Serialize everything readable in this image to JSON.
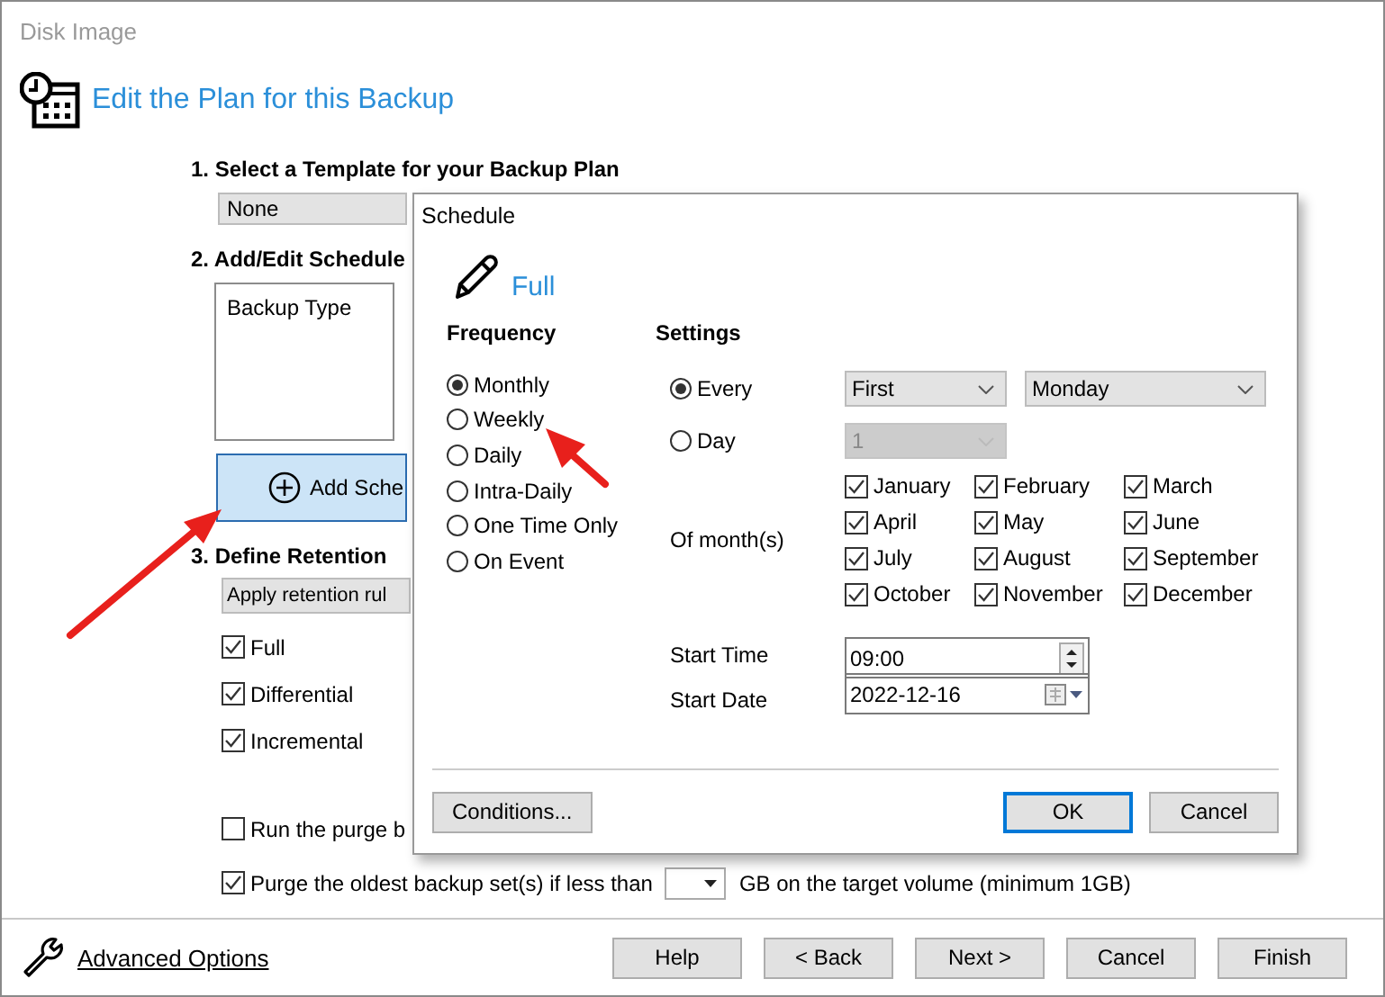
{
  "window": {
    "title": "Disk Image"
  },
  "header": {
    "title": "Edit the Plan for this Backup"
  },
  "template_section": {
    "heading": "1. Select a Template for your Backup Plan",
    "value": "None"
  },
  "schedule_section": {
    "heading": "2. Add/Edit Schedule",
    "column": "Backup Type",
    "add_button": "Add Sche"
  },
  "retention_section": {
    "heading": "3. Define Retention",
    "value": "Apply retention rul",
    "checks": [
      {
        "label": "Full",
        "checked": true
      },
      {
        "label": "Differential",
        "checked": true
      },
      {
        "label": "Incremental",
        "checked": true
      }
    ],
    "purge_checks": [
      {
        "label": "Run the purge b",
        "checked": false
      },
      {
        "label": "Purge the oldest backup set(s) if less than",
        "checked": true
      }
    ],
    "purge_suffix": "GB on the target volume (minimum 1GB)"
  },
  "footer": {
    "link": "Advanced Options",
    "buttons": [
      "Help",
      "< Back",
      "Next >",
      "Cancel",
      "Finish"
    ]
  },
  "dialog": {
    "title": "Schedule",
    "backup_type": "Full",
    "frequency": {
      "heading": "Frequency",
      "options": [
        {
          "label": "Monthly",
          "selected": true
        },
        {
          "label": "Weekly",
          "selected": false
        },
        {
          "label": "Daily",
          "selected": false
        },
        {
          "label": "Intra-Daily",
          "selected": false
        },
        {
          "label": "One Time Only",
          "selected": false
        },
        {
          "label": "On Event",
          "selected": false
        }
      ]
    },
    "settings": {
      "heading": "Settings",
      "modes": [
        {
          "label": "Every",
          "selected": true
        },
        {
          "label": "Day",
          "selected": false
        }
      ],
      "every_combos": [
        "First",
        "Monday"
      ],
      "day_combo": {
        "value": "1",
        "disabled": true
      },
      "months_label": "Of month(s)",
      "months": [
        {
          "label": "January",
          "checked": true
        },
        {
          "label": "February",
          "checked": true
        },
        {
          "label": "March",
          "checked": true
        },
        {
          "label": "April",
          "checked": true
        },
        {
          "label": "May",
          "checked": true
        },
        {
          "label": "June",
          "checked": true
        },
        {
          "label": "July",
          "checked": true
        },
        {
          "label": "August",
          "checked": true
        },
        {
          "label": "September",
          "checked": true
        },
        {
          "label": "October",
          "checked": true
        },
        {
          "label": "November",
          "checked": true
        },
        {
          "label": "December",
          "checked": true
        }
      ],
      "start_time": {
        "label": "Start Time",
        "value": "09:00"
      },
      "start_date": {
        "label": "Start Date",
        "value": "2022-12-16"
      }
    },
    "buttons": {
      "conditions": "Conditions...",
      "ok": "OK",
      "cancel": "Cancel"
    }
  }
}
